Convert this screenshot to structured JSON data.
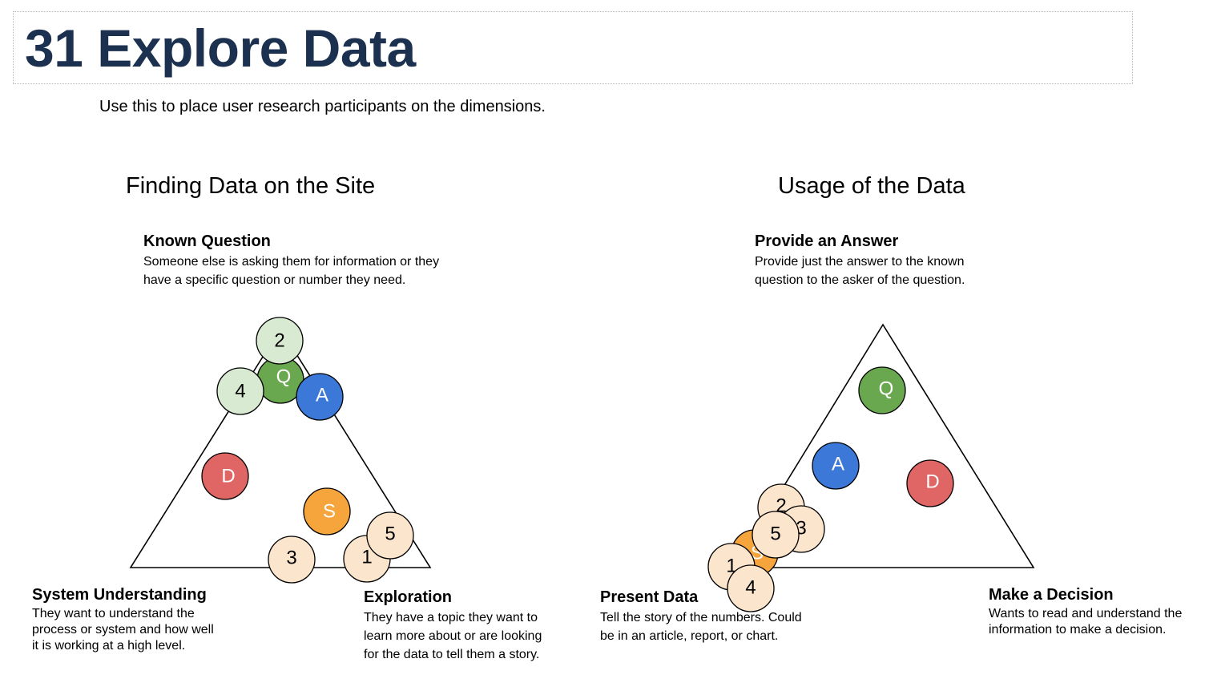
{
  "title": "31 Explore Data",
  "subtitle": "Use this to place user research participants on the dimensions.",
  "left": {
    "section_title": "Finding Data on the Site",
    "top_label": "Known Question",
    "top_desc_1": "Someone else is asking them for information or they",
    "top_desc_2": "have a specific question or number they need.",
    "bl_label": "System Understanding",
    "bl_desc_1": "They want to understand the",
    "bl_desc_2": "process or system and how well",
    "bl_desc_3": "it is working at a high level.",
    "br_label": "Exploration",
    "br_desc_1": "They have a topic they want to",
    "br_desc_2": "learn more about or are looking",
    "br_desc_3": "for the data to tell them a story."
  },
  "right": {
    "section_title": "Usage of the Data",
    "top_label": "Provide an Answer",
    "top_desc_1": "Provide just the answer to the known",
    "top_desc_2": "question to the asker of the question.",
    "bl_label": "Present Data",
    "bl_desc_1": "Tell the story of the numbers.  Could",
    "bl_desc_2": "be in an article, report, or chart.",
    "br_label": "Make a Decision",
    "br_desc_1": "Wants to read and understand the",
    "br_desc_2": "information to make a decision."
  },
  "colors": {
    "Q": "#6aa84f",
    "A": "#3c78d8",
    "D": "#e06666",
    "S": "#f6a53c",
    "participant_light_green": "#d9ead3",
    "participant_peach": "#fce5cd",
    "title": "#1c3150"
  },
  "markers": {
    "Q": "Q",
    "A": "A",
    "D": "D",
    "S": "S",
    "p1": "1",
    "p2": "2",
    "p3": "3",
    "p4": "4",
    "p5": "5"
  }
}
